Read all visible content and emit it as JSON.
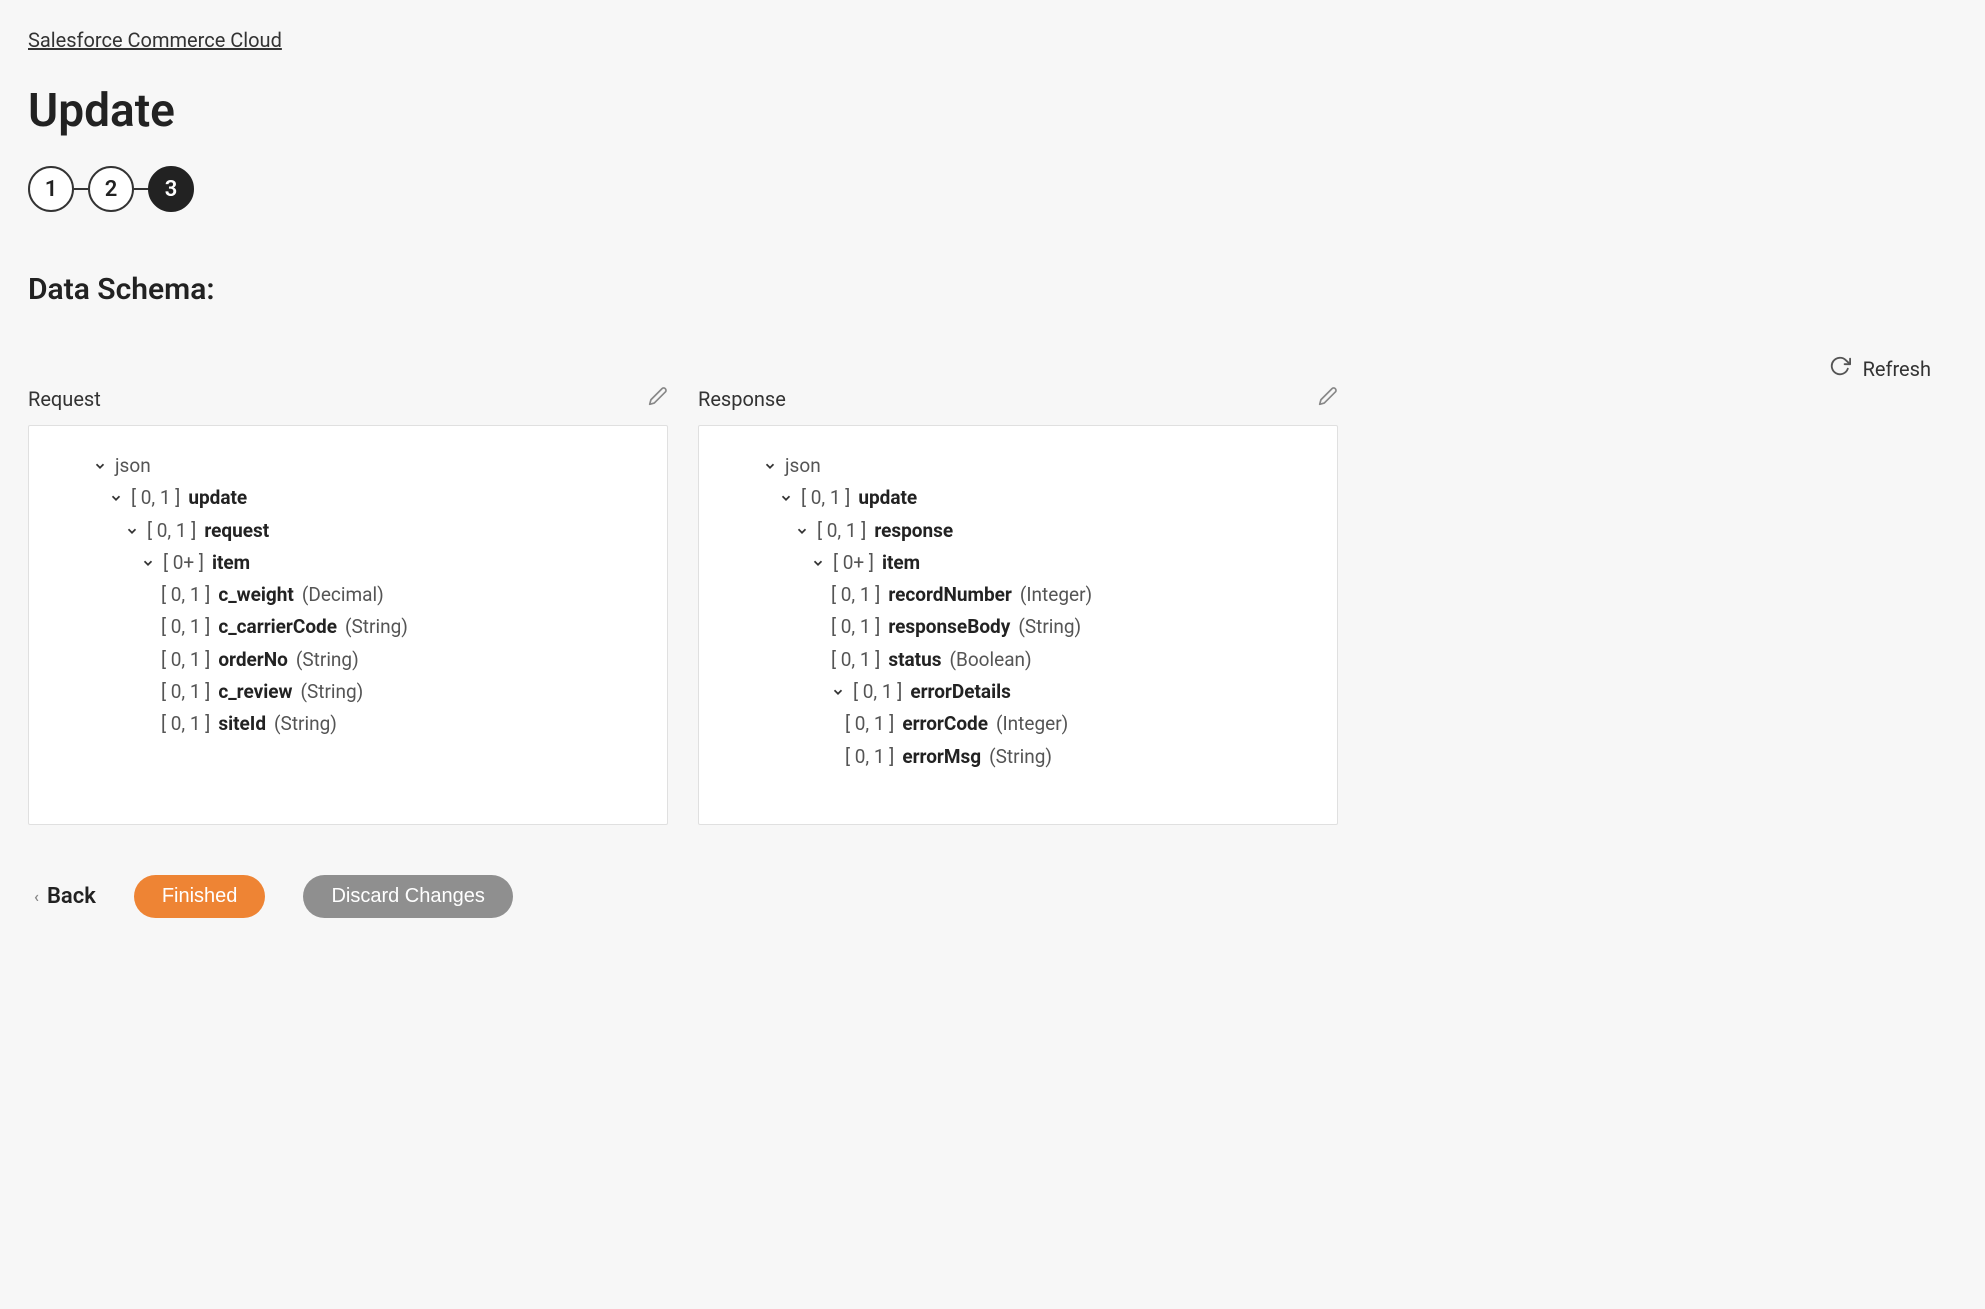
{
  "breadcrumb": {
    "label": "Salesforce Commerce Cloud"
  },
  "page": {
    "title": "Update"
  },
  "stepper": {
    "steps": [
      "1",
      "2",
      "3"
    ],
    "activeIndex": 2
  },
  "section": {
    "title": "Data Schema:"
  },
  "refresh": {
    "label": "Refresh"
  },
  "request": {
    "header": "Request",
    "root": "json",
    "tree": [
      {
        "indent": 1,
        "chevron": true,
        "card": "[ 0, 1 ]",
        "name": "update"
      },
      {
        "indent": 2,
        "chevron": true,
        "card": "[ 0, 1 ]",
        "name": "request"
      },
      {
        "indent": 3,
        "chevron": true,
        "card": "[ 0+ ]",
        "name": "item"
      },
      {
        "indent": 4,
        "chevron": false,
        "card": "[ 0, 1 ]",
        "name": "c_weight",
        "type": "(Decimal)"
      },
      {
        "indent": 4,
        "chevron": false,
        "card": "[ 0, 1 ]",
        "name": "c_carrierCode",
        "type": "(String)"
      },
      {
        "indent": 4,
        "chevron": false,
        "card": "[ 0, 1 ]",
        "name": "orderNo",
        "type": "(String)"
      },
      {
        "indent": 4,
        "chevron": false,
        "card": "[ 0, 1 ]",
        "name": "c_review",
        "type": "(String)"
      },
      {
        "indent": 4,
        "chevron": false,
        "card": "[ 0, 1 ]",
        "name": "siteId",
        "type": "(String)"
      }
    ]
  },
  "response": {
    "header": "Response",
    "root": "json",
    "tree": [
      {
        "indent": 1,
        "chevron": true,
        "card": "[ 0, 1 ]",
        "name": "update"
      },
      {
        "indent": 2,
        "chevron": true,
        "card": "[ 0, 1 ]",
        "name": "response"
      },
      {
        "indent": 3,
        "chevron": true,
        "card": "[ 0+ ]",
        "name": "item"
      },
      {
        "indent": 4,
        "chevron": false,
        "card": "[ 0, 1 ]",
        "name": "recordNumber",
        "type": "(Integer)"
      },
      {
        "indent": 4,
        "chevron": false,
        "card": "[ 0, 1 ]",
        "name": "responseBody",
        "type": "(String)"
      },
      {
        "indent": 4,
        "chevron": false,
        "card": "[ 0, 1 ]",
        "name": "status",
        "type": "(Boolean)"
      },
      {
        "indent": 4,
        "chevron": true,
        "card": "[ 0, 1 ]",
        "name": "errorDetails"
      },
      {
        "indent": 5,
        "chevron": false,
        "card": "[ 0, 1 ]",
        "name": "errorCode",
        "type": "(Integer)"
      },
      {
        "indent": 5,
        "chevron": false,
        "card": "[ 0, 1 ]",
        "name": "errorMsg",
        "type": "(String)"
      }
    ]
  },
  "footer": {
    "back": "Back",
    "finished": "Finished",
    "discard": "Discard Changes"
  }
}
